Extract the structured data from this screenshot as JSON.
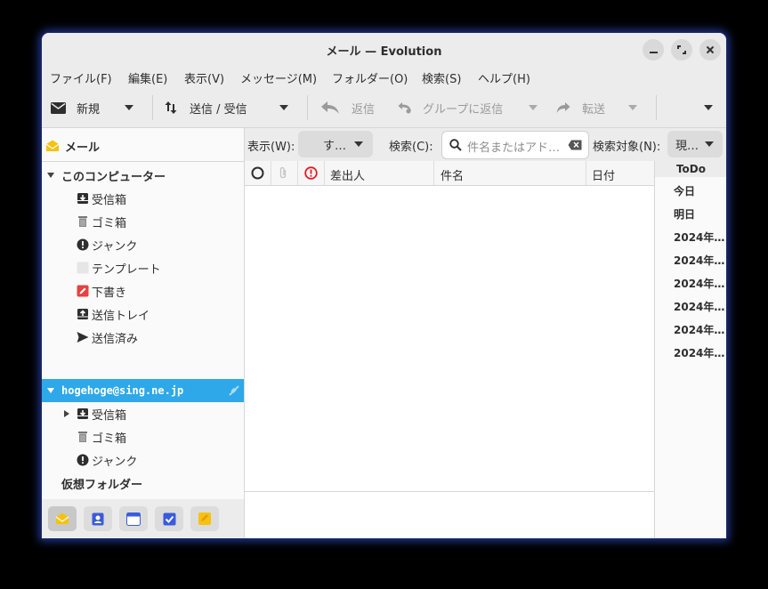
{
  "window": {
    "title": "メール — Evolution"
  },
  "menubar": {
    "items": [
      "ファイル(F)",
      "編集(E)",
      "表示(V)",
      "メッセージ(M)",
      "フォルダー(O)",
      "検索(S)",
      "ヘルプ(H)"
    ]
  },
  "toolbar": {
    "new_label": "新規",
    "send_receive_label": "送信 / 受信",
    "reply_label": "返信",
    "reply_group_label": "グループに返信",
    "forward_label": "転送"
  },
  "sidebar": {
    "header": "メール",
    "local_group": "このコンピューター",
    "local_items": [
      {
        "label": "受信箱",
        "icon": "inbox-icon"
      },
      {
        "label": "ゴミ箱",
        "icon": "trash-icon"
      },
      {
        "label": "ジャンク",
        "icon": "junk-icon"
      },
      {
        "label": "テンプレート",
        "icon": "templates-icon"
      },
      {
        "label": "下書き",
        "icon": "drafts-icon"
      },
      {
        "label": "送信トレイ",
        "icon": "outbox-icon"
      },
      {
        "label": "送信済み",
        "icon": "sent-icon"
      }
    ],
    "account": "hogehoge@sing.ne.jp",
    "account_items": [
      {
        "label": "受信箱",
        "icon": "inbox-icon"
      },
      {
        "label": "ゴミ箱",
        "icon": "trash-icon"
      },
      {
        "label": "ジャンク",
        "icon": "junk-icon"
      }
    ],
    "virtual_folders": "仮想フォルダー",
    "switcher": [
      "mail-icon",
      "contacts-icon",
      "calendar-icon",
      "tasks-icon",
      "memos-icon"
    ]
  },
  "filterbar": {
    "show_label": "表示(W):",
    "show_value": "す…",
    "search_label": "検索(C):",
    "search_placeholder": "件名またはアド…",
    "scope_label": "検索対象(N):",
    "scope_value": "現…"
  },
  "columns": {
    "from": "差出人",
    "subject": "件名",
    "date": "日付"
  },
  "todo": {
    "header": "ToDo",
    "items": [
      "今日",
      "明日",
      "2024年…",
      "2024年…",
      "2024年…",
      "2024年…",
      "2024年…",
      "2024年…"
    ]
  },
  "colors": {
    "accent": "#2ea8e8",
    "window_bg": "#fafafa",
    "chrome_bg": "#ececec"
  }
}
